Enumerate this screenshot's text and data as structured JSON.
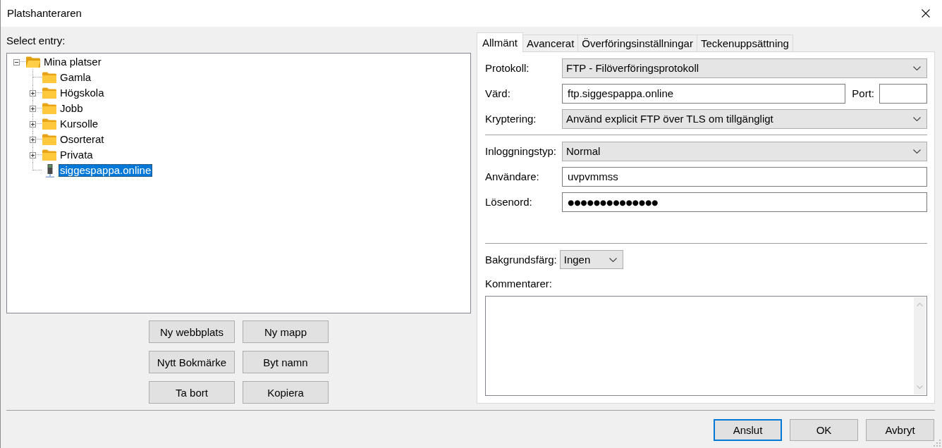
{
  "window": {
    "title": "Platshanteraren"
  },
  "site_tree": {
    "label": "Select entry:",
    "items": [
      {
        "label": "Mina platser",
        "kind": "folder",
        "expandable": true,
        "expanded": true,
        "selected": false,
        "children": [
          {
            "label": "Gamla",
            "kind": "folder",
            "expandable": false,
            "selected": false
          },
          {
            "label": "Högskola",
            "kind": "folder",
            "expandable": true,
            "expanded": false,
            "selected": false
          },
          {
            "label": "Jobb",
            "kind": "folder",
            "expandable": true,
            "expanded": false,
            "selected": false
          },
          {
            "label": "Kursolle",
            "kind": "folder",
            "expandable": true,
            "expanded": false,
            "selected": false
          },
          {
            "label": "Osorterat",
            "kind": "folder",
            "expandable": true,
            "expanded": false,
            "selected": false
          },
          {
            "label": "Privata",
            "kind": "folder",
            "expandable": true,
            "expanded": false,
            "selected": false
          },
          {
            "label": "siggespappa.online",
            "kind": "site",
            "expandable": false,
            "selected": true
          }
        ]
      }
    ]
  },
  "site_buttons": [
    "Ny webbplats",
    "Ny mapp",
    "Nytt Bokmärke",
    "Byt namn",
    "Ta bort",
    "Kopiera"
  ],
  "tabs": [
    {
      "label": "Allmänt",
      "selected": true
    },
    {
      "label": "Avancerat",
      "selected": false
    },
    {
      "label": "Överföringsinställningar",
      "selected": false
    },
    {
      "label": "Teckenuppsättning",
      "selected": false
    }
  ],
  "general": {
    "sections": [
      {
        "fields": [
          {
            "kind": "dropdown",
            "label": "Protokoll:",
            "value": "FTP - Filöverföringsprotokoll"
          },
          {
            "kind": "host",
            "label": "Värd:",
            "value": "ftp.siggespappa.online",
            "port_label": "Port:"
          },
          {
            "kind": "dropdown",
            "label": "Kryptering:",
            "value": "Använd explicit FTP över TLS om tillgängligt"
          }
        ]
      },
      {
        "fields": [
          {
            "kind": "dropdown",
            "label": "Inloggningstyp:",
            "value": "Normal"
          },
          {
            "kind": "text",
            "label": "Användare:",
            "value": "uvpvmmss"
          },
          {
            "kind": "password",
            "label": "Lösenord:",
            "value": "●●●●●●●●●●●●●●"
          }
        ]
      },
      {
        "fields": [
          {
            "kind": "dropdown_inline",
            "label": "Bakgrundsfärg:",
            "value": "Ingen"
          },
          {
            "kind": "textarea",
            "label": "Kommentarer:"
          }
        ]
      }
    ]
  },
  "footer_buttons": [
    {
      "label": "Anslut",
      "focused": true
    },
    {
      "label": "OK",
      "focused": false
    },
    {
      "label": "Avbryt",
      "focused": false
    }
  ]
}
